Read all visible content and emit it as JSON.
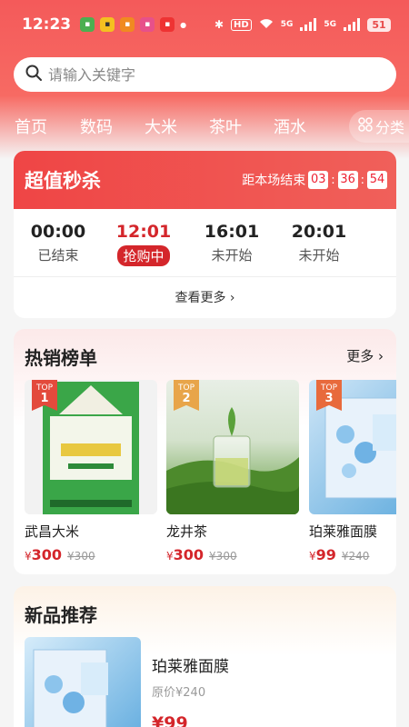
{
  "status_bar": {
    "time": "12:23",
    "battery": "51",
    "hd": "HD",
    "net1": "5G",
    "net2": "5G",
    "notif_icons": [
      "message-icon",
      "app-mini-icon",
      "grid-app-icon",
      "live-icon",
      "gift-icon"
    ]
  },
  "search": {
    "placeholder": "请输入关键字"
  },
  "tabs": [
    "首页",
    "数码",
    "大米",
    "茶叶",
    "酒水"
  ],
  "category_button": {
    "label": "分类"
  },
  "flash_sale": {
    "title": "超值秒杀",
    "countdown_label": "距本场结束",
    "hours": "03",
    "minutes": "36",
    "seconds": "54",
    "slots": [
      {
        "time": "00:00",
        "status": "已结束",
        "active": false
      },
      {
        "time": "12:01",
        "status": "抢购中",
        "active": true
      },
      {
        "time": "16:01",
        "status": "未开始",
        "active": false
      },
      {
        "time": "20:01",
        "status": "未开始",
        "active": false
      }
    ],
    "more_label": "查看更多"
  },
  "hot_list": {
    "title": "热销榜单",
    "more_label": "更多",
    "products": [
      {
        "rank_label": "TOP",
        "rank": "1",
        "name": "武昌大米",
        "price_symbol": "¥",
        "price": "300",
        "original_price": "¥300",
        "tag_color": "#e34a3c"
      },
      {
        "rank_label": "TOP",
        "rank": "2",
        "name": "龙井茶",
        "price_symbol": "¥",
        "price": "300",
        "original_price": "¥300",
        "tag_color": "#e8a54a"
      },
      {
        "rank_label": "TOP",
        "rank": "3",
        "name": "珀莱雅面膜",
        "price_symbol": "¥",
        "price": "99",
        "original_price": "¥240",
        "tag_color": "#e86a3c"
      }
    ]
  },
  "new_products": {
    "title": "新品推荐",
    "item": {
      "name": "珀莱雅面膜",
      "original_price": "原价¥240",
      "price": "¥99"
    }
  },
  "colors": {
    "accent": "#d4262b",
    "header": "#f45a5a"
  }
}
